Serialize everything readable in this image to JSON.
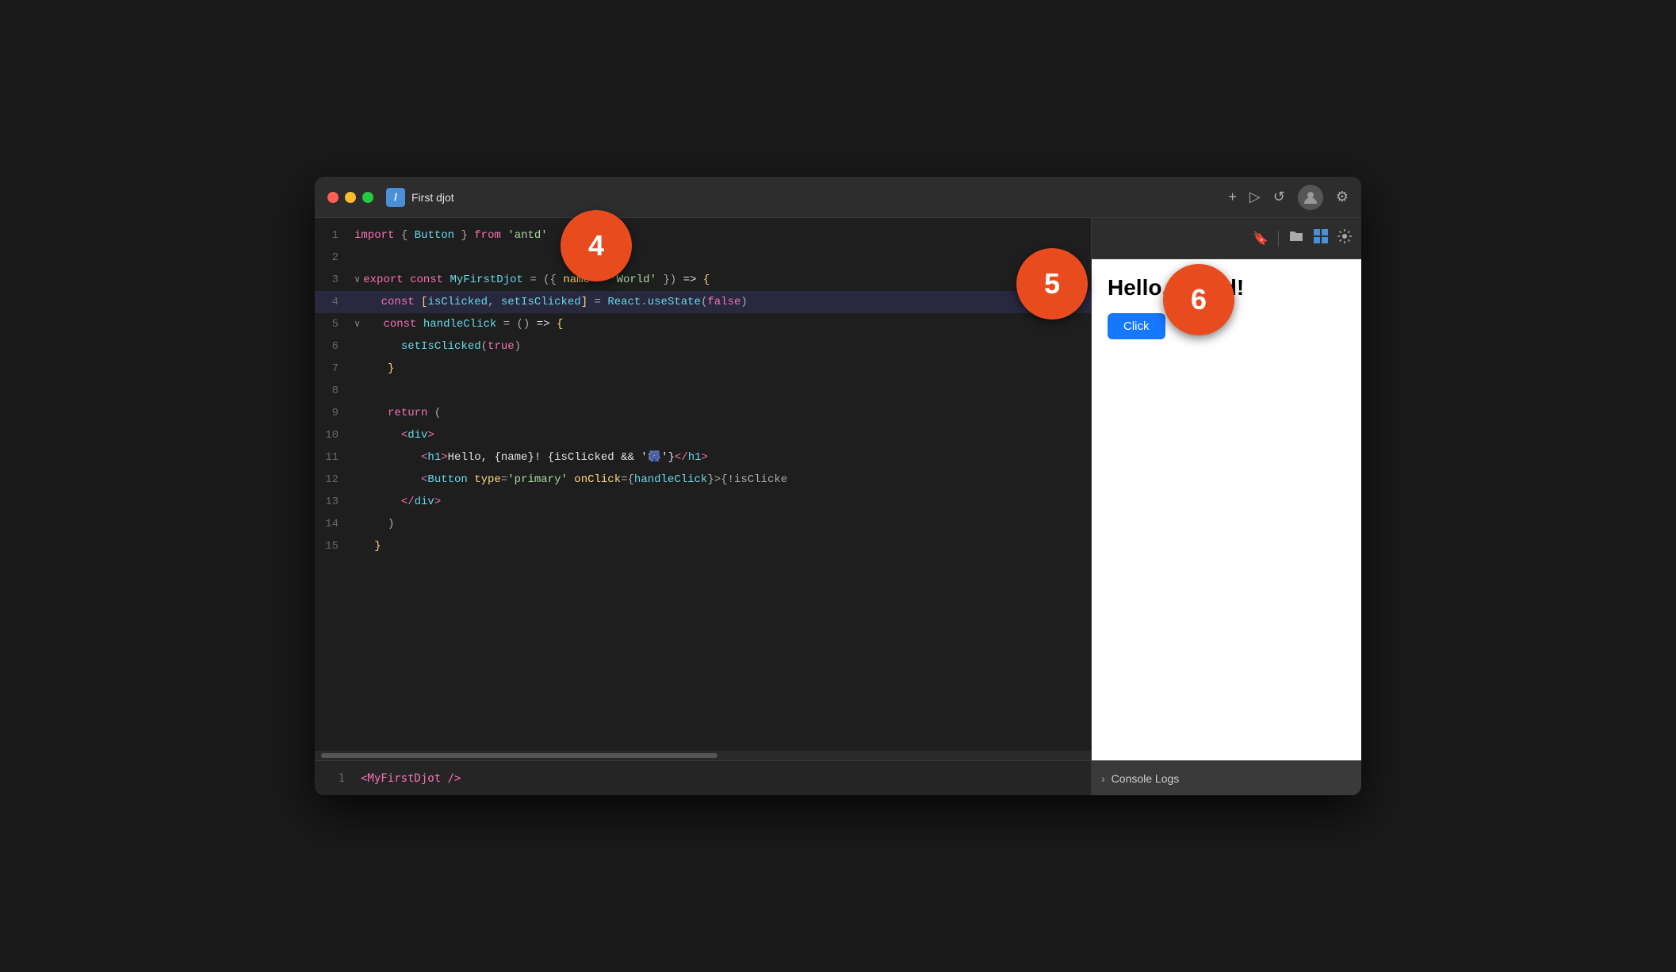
{
  "window": {
    "title": "First djot",
    "tab_icon": "/"
  },
  "titlebar": {
    "traffic_lights": [
      "red",
      "yellow",
      "green"
    ],
    "tab_label": "First djot",
    "buttons": {
      "add": "+",
      "play": "▷",
      "refresh": "↺",
      "settings": "⚙"
    }
  },
  "editor": {
    "lines": [
      {
        "num": "1",
        "highlighted": false,
        "content_html": "<span class='kw-import'>import</span> <span class='punctuation'>{ </span><span class='fn-name'>Button</span><span class='punctuation'> }</span> <span class='kw-import'>from</span> <span class='str'>'antd'</span>"
      },
      {
        "num": "2",
        "highlighted": false,
        "content_html": ""
      },
      {
        "num": "3",
        "highlighted": false,
        "chevron": true,
        "content_html": "<span class='kw-export'>export</span> <span class='kw-const'>const</span> <span class='fn-name'>MyFirstDjot</span> <span class='punctuation'>=</span> <span class='punctuation'>({</span> <span class='attr'>name</span> <span class='punctuation'>=</span> <span class='str'>'World'</span> <span class='punctuation'>})</span> <span class='arrow'>=&gt;</span> <span class='bracket'>{</span>"
      },
      {
        "num": "4",
        "highlighted": true,
        "content_html": "<span class='kw-const'>const</span> <span class='bracket'>[</span><span class='fn-name'>isClicked</span><span class='punctuation'>,</span> <span class='fn-name'>setIsClicked</span><span class='bracket'>]</span> <span class='punctuation'>=</span> <span class='fn-name'>React</span><span class='punctuation'>.</span><span class='fn-name'>useState</span><span class='punctuation'>(</span><span class='kw-false'>false</span><span class='punctuation'>)</span>"
      },
      {
        "num": "5",
        "highlighted": false,
        "chevron": true,
        "content_html": "<span class='kw-const'>const</span> <span class='fn-name'>handleClick</span> <span class='punctuation'>=</span> <span class='punctuation'>()</span> <span class='arrow'>=&gt;</span> <span class='bracket'>{</span>"
      },
      {
        "num": "6",
        "highlighted": false,
        "content_html": "<span class='fn-name'>setIsClicked</span><span class='punctuation'>(</span><span class='kw-true'>true</span><span class='punctuation'>)</span>"
      },
      {
        "num": "7",
        "highlighted": false,
        "content_html": "<span class='bracket'>}</span>"
      },
      {
        "num": "8",
        "highlighted": false,
        "content_html": ""
      },
      {
        "num": "9",
        "highlighted": false,
        "content_html": "<span class='kw-return'>return</span> <span class='punctuation'>(</span>"
      },
      {
        "num": "10",
        "highlighted": false,
        "content_html": "<span class='tag'>&lt;</span><span class='tag-name'>div</span><span class='tag'>&gt;</span>"
      },
      {
        "num": "11",
        "highlighted": false,
        "content_html": "<span class='tag'>&lt;</span><span class='tag-name'>h1</span><span class='tag'>&gt;</span><span class='jsx-expr'>Hello, {name}! {isClicked &amp;&amp; '🎆'}</span><span class='tag'>&lt;/</span><span class='tag-name'>h1</span><span class='tag'>&gt;</span>"
      },
      {
        "num": "12",
        "highlighted": false,
        "content_html": "<span class='tag'>&lt;</span><span class='tag-name'>Button</span> <span class='attr'>type</span><span class='punctuation'>=</span><span class='str'>'primary'</span> <span class='attr'>onClick</span><span class='punctuation'>={</span><span class='fn-name'>handleClick</span><span class='punctuation'>}>{!isClicke</span><span class='comment'>...</span>"
      },
      {
        "num": "13",
        "highlighted": false,
        "content_html": "<span class='tag'>&lt;/</span><span class='tag-name'>div</span><span class='tag'>&gt;</span>"
      },
      {
        "num": "14",
        "highlighted": false,
        "content_html": "<span class='punctuation'>)</span>"
      },
      {
        "num": "15",
        "highlighted": false,
        "content_html": "<span class='bracket'>}</span>"
      }
    ],
    "bottom_line": "1",
    "bottom_code": "<MyFirstDjot />"
  },
  "preview": {
    "title": "Hello, World!",
    "click_button_label": "Click",
    "console_label": "Console Logs"
  },
  "annotations": [
    {
      "id": "4",
      "label": "4"
    },
    {
      "id": "5",
      "label": "5"
    },
    {
      "id": "6",
      "label": "6"
    }
  ]
}
